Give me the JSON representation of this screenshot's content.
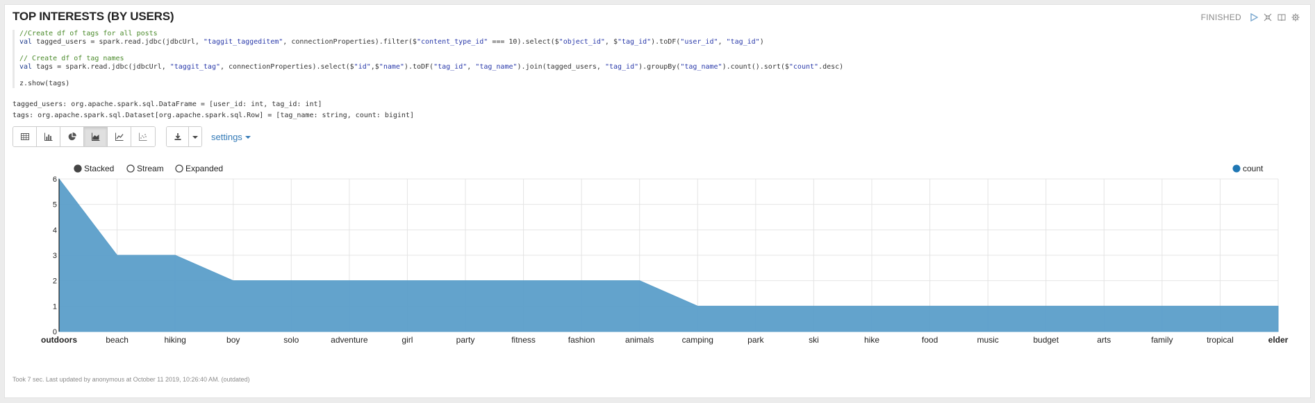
{
  "paragraph": {
    "title": "TOP INTERESTS (BY USERS)",
    "status": "FINISHED",
    "footer": "Took 7 sec. Last updated by anonymous at October 11 2019, 10:26:40 AM. (outdated)"
  },
  "icons": {
    "run": "play-icon",
    "hide_editor": "expand-collapse-icon",
    "hide_output": "book-icon",
    "settings": "gear-icon"
  },
  "code": {
    "line1": "//Create df of tags for all posts",
    "line2_kw": "val",
    "line2_pre": " tagged_users = spark.read.jdbc(jdbcUrl, ",
    "line2_s1": "\"taggit_taggeditem\"",
    "line2_mid1": ", connectionProperties).filter($",
    "line2_s2": "\"content_type_id\"",
    "line2_mid2": " === 10).select($",
    "line2_s3": "\"object_id\"",
    "line2_mid3": ", $",
    "line2_s4": "\"tag_id\"",
    "line2_mid4": ").toDF(",
    "line2_s5": "\"user_id\"",
    "line2_mid5": ", ",
    "line2_s6": "\"tag_id\"",
    "line2_end": ")",
    "line3": "// Create df of tag names",
    "line4_kw": "val",
    "line4_pre": " tags = spark.read.jdbc(jdbcUrl, ",
    "line4_s1": "\"taggit_tag\"",
    "line4_mid1": ", connectionProperties).select($",
    "line4_s2": "\"id\"",
    "line4_mid2": ",$",
    "line4_s3": "\"name\"",
    "line4_mid3": ").toDF(",
    "line4_s4": "\"tag_id\"",
    "line4_mid4": ", ",
    "line4_s5": "\"tag_name\"",
    "line4_mid5": ").join(tagged_users, ",
    "line4_s6": "\"tag_id\"",
    "line4_mid6": ").groupBy(",
    "line4_s7": "\"tag_name\"",
    "line4_mid7": ").count().sort($",
    "line4_s8": "\"count\"",
    "line4_end": ".desc)",
    "line5": "z.show(tags)"
  },
  "output": {
    "line1": "tagged_users: org.apache.spark.sql.DataFrame = [user_id: int, tag_id: int]",
    "line2": "tags: org.apache.spark.sql.Dataset[org.apache.spark.sql.Row] = [tag_name: string, count: bigint]"
  },
  "toolbar": {
    "buttons": [
      "table-icon",
      "bar-chart-icon",
      "pie-chart-icon",
      "area-chart-icon",
      "line-chart-icon",
      "scatter-chart-icon"
    ],
    "active": "area-chart-icon",
    "download": "download-icon",
    "settings_label": "settings"
  },
  "chart_options": {
    "modes": [
      "Stacked",
      "Stream",
      "Expanded"
    ],
    "selected": "Stacked"
  },
  "chart_data": {
    "type": "area",
    "categories": [
      "outdoors",
      "beach",
      "hiking",
      "boy",
      "solo",
      "adventure",
      "girl",
      "party",
      "fitness",
      "fashion",
      "animals",
      "camping",
      "park",
      "ski",
      "hike",
      "food",
      "music",
      "budget",
      "arts",
      "family",
      "tropical",
      "elder"
    ],
    "series": [
      {
        "name": "count",
        "values": [
          6,
          3,
          3,
          2,
          2,
          2,
          2,
          2,
          2,
          2,
          2,
          1,
          1,
          1,
          1,
          1,
          1,
          1,
          1,
          1,
          1,
          1
        ],
        "color": "#5b9ec9"
      }
    ],
    "ylim": [
      0,
      6
    ],
    "yticks": [
      0,
      1,
      2,
      3,
      4,
      5,
      6
    ],
    "legend": "top-right",
    "grid": true
  }
}
